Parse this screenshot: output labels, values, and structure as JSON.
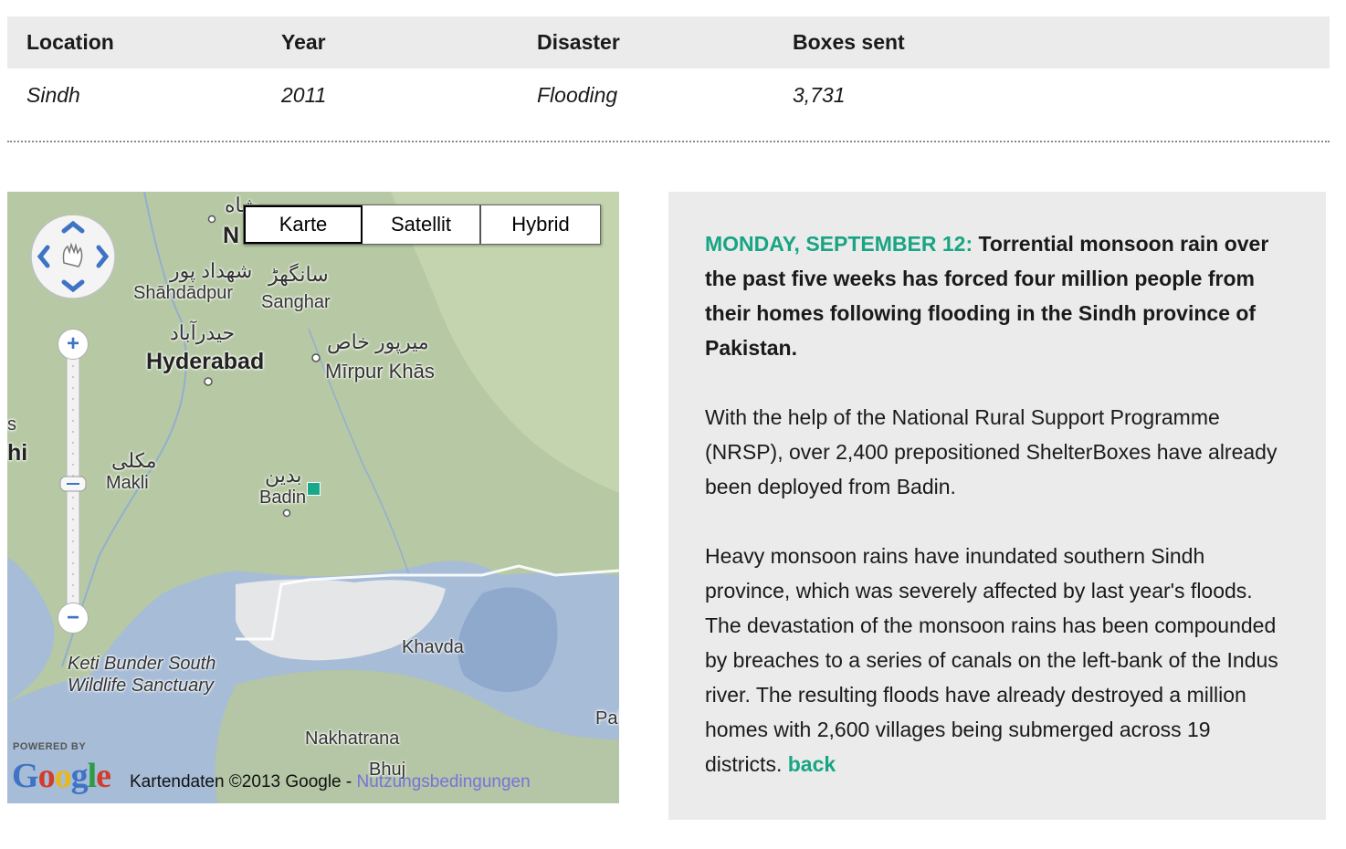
{
  "table": {
    "headers": [
      "Location",
      "Year",
      "Disaster",
      "Boxes sent"
    ],
    "row": [
      "Sindh",
      "2011",
      "Flooding",
      "3,731"
    ]
  },
  "map": {
    "type_buttons": [
      "Karte",
      "Satellit",
      "Hybrid"
    ],
    "places": {
      "hyderabad": "Hyderabad",
      "hyderabad_native": "حیدرآباد",
      "shahdadpur": "Shāhdādpur",
      "shahdadpur_native": "شهداد پور",
      "sanghar": "Sanghar",
      "sanghar_native": "سانگھڑ",
      "mirpur_khas": "Mīrpur Khās",
      "mirpur_khas_native": "میرپور خاص",
      "makli": "Makli",
      "makli_native": "مکلی",
      "badin": "Badin",
      "badin_native": "بدین",
      "keti_bunder": "Keti Bunder South",
      "wildlife_sanctuary": "Wildlife Sanctuary",
      "khavda": "Khavda",
      "nakhatrana": "Nakhatrana",
      "bhuj": "Bhuj",
      "pal": "Pal",
      "hi": "hi",
      "s": "s",
      "n": "N"
    },
    "powered_by": "POWERED BY",
    "logo": "Google",
    "attribution": "Kartendaten ©2013 Google -",
    "terms_link": "Nutzungsbedingungen",
    "marker_color": "#19a88a"
  },
  "article": {
    "dateline": "MONDAY, SEPTEMBER 12:",
    "lead": "Torrential monsoon rain over the past five weeks has forced four million people from their homes following flooding in the Sindh province of Pakistan.",
    "para2": "With the help of the National Rural Support Programme (NRSP), over 2,400 prepositioned ShelterBoxes have already been deployed from Badin.",
    "para3": "Heavy monsoon rains have inundated southern Sindh province, which was severely affected by last year's floods. The devastation of the monsoon rains has been compounded by breaches to a series of canals on the left-bank of the Indus river. The resulting floods have already destroyed a million homes with 2,600 villages being submerged across 19 districts.",
    "back_link": "back",
    "accent_color": "#17a584"
  }
}
